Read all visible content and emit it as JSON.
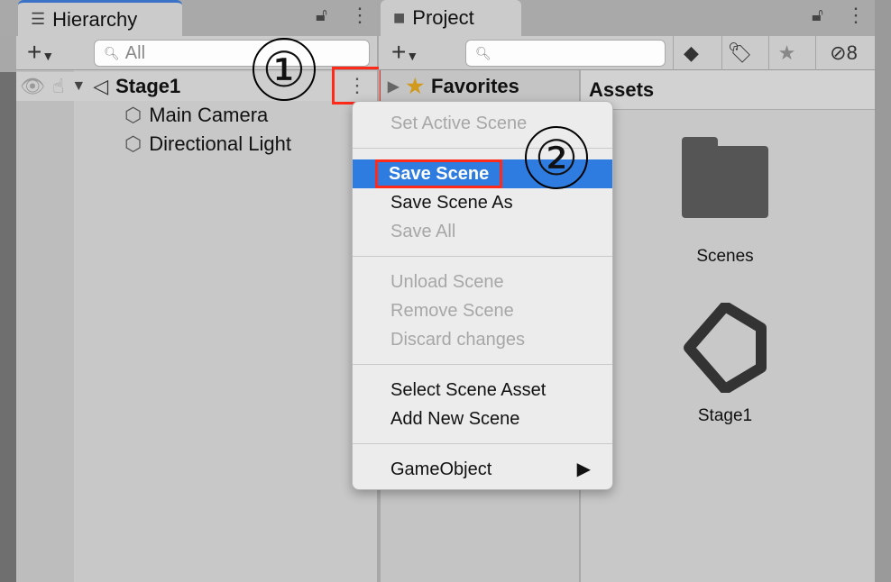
{
  "hierarchy": {
    "tab_label": "Hierarchy",
    "search_placeholder": "All",
    "scene_name": "Stage1",
    "items": [
      "Main Camera",
      "Directional Light"
    ]
  },
  "project": {
    "tab_label": "Project",
    "favorites_label": "Favorites",
    "assets_header": "Assets",
    "hidden_count": "8",
    "assets": [
      {
        "name": "Scenes",
        "icon": "folder-icon"
      },
      {
        "name": "Stage1",
        "icon": "unity-scene-icon"
      }
    ]
  },
  "menu": {
    "items": [
      {
        "label": "Set Active Scene",
        "enabled": false
      },
      {
        "label": "Save Scene",
        "enabled": true,
        "highlighted": true
      },
      {
        "label": "Save Scene As",
        "enabled": true
      },
      {
        "label": "Save All",
        "enabled": false
      },
      {
        "label": "Unload Scene",
        "enabled": false
      },
      {
        "label": "Remove Scene",
        "enabled": false
      },
      {
        "label": "Discard changes",
        "enabled": false
      },
      {
        "label": "Select Scene Asset",
        "enabled": true
      },
      {
        "label": "Add New Scene",
        "enabled": true
      },
      {
        "label": "GameObject",
        "enabled": true,
        "submenu": true
      }
    ]
  },
  "annotations": {
    "step1": "①",
    "step2": "②",
    "highlight_color": "#ff2a1a"
  },
  "colors": {
    "selection": "#2f7ce0",
    "tab_accent": "#3a72c8"
  }
}
